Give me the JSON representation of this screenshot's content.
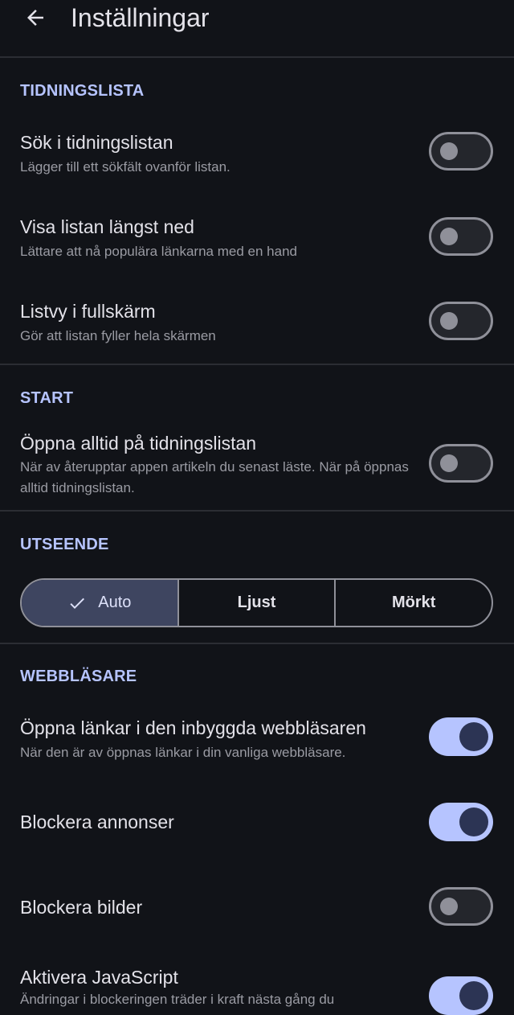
{
  "header": {
    "title": "Inställningar",
    "back_icon": "arrow-left-icon"
  },
  "sections": {
    "newspaper_list": {
      "header": "TIDNINGSLISTA",
      "items": [
        {
          "title": "Sök i tidningslistan",
          "subtitle": "Lägger till ett sökfält ovanför listan.",
          "enabled": false
        },
        {
          "title": "Visa listan längst ned",
          "subtitle": "Lättare att nå populära länkarna med en hand",
          "enabled": false
        },
        {
          "title": "Listvy i fullskärm",
          "subtitle": "Gör att listan fyller hela skärmen",
          "enabled": false
        }
      ]
    },
    "start": {
      "header": "START",
      "items": [
        {
          "title": "Öppna alltid på tidningslistan",
          "subtitle": "När av återupptar appen artikeln du senast läste. När på öppnas alltid tidningslistan.",
          "enabled": false
        }
      ]
    },
    "appearance": {
      "header": "UTSEENDE",
      "options": [
        "Auto",
        "Ljust",
        "Mörkt"
      ],
      "selected": "Auto"
    },
    "browser": {
      "header": "WEBBLÄSARE",
      "items": [
        {
          "title": "Öppna länkar i den inbyggda webbläsaren",
          "subtitle": "När den är av öppnas länkar i din vanliga webbläsare.",
          "enabled": true
        },
        {
          "title": "Blockera annonser",
          "enabled": true
        },
        {
          "title": "Blockera bilder",
          "enabled": false
        },
        {
          "title": "Aktivera JavaScript",
          "subtitle": "Ändringar i blockeringen träder i kraft nästa gång du",
          "enabled": true
        }
      ]
    }
  },
  "colors": {
    "background": "#111318",
    "accent": "#b6c4ff",
    "toggle_on_knob": "#2c3454",
    "toggle_off_outline": "#8f9099",
    "segment_selected": "#3e4560"
  }
}
